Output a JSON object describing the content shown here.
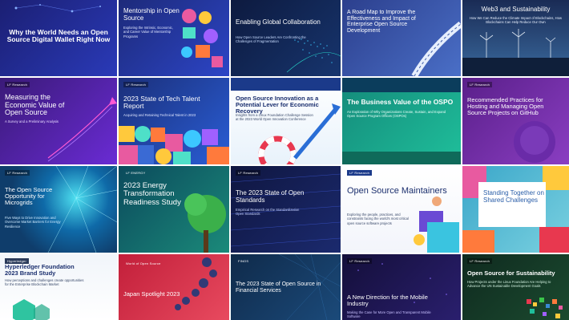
{
  "tiles": [
    {
      "title": "Why the World Needs an Open Source Digital Wallet Right Now",
      "subtitle": "",
      "colors": [
        "#1b1f73",
        "#2a3ab8"
      ]
    },
    {
      "title": "Mentorship in Open Source",
      "subtitle": "Exploring the Intrinsic, Economic, and Career Value of Mentorship Programs",
      "colors": [
        "#1d2a7a",
        "#2c45c6"
      ]
    },
    {
      "title": "Enabling Global Collaboration",
      "subtitle": "How Open Source Leaders Are Confronting the Challenges of Fragmentation",
      "colors": [
        "#0d1a3f",
        "#17356e"
      ]
    },
    {
      "title": "A Road Map to Improve the Effectiveness and Impact of Enterprise Open Source Development",
      "subtitle": "",
      "colors": [
        "#2c3f8d",
        "#4a6fc7"
      ]
    },
    {
      "title": "Web3 and Sustainability",
      "subtitle": "How We Can Reduce the Climate Impact of Blockchains, How Blockchains Can Help Reduce Our Own",
      "colors": [
        "#1a2b55",
        "#3a6a9e"
      ]
    },
    {
      "title": "Measuring the Economic Value of Open Source",
      "subtitle": "A Survey and a Preliminary Analysis",
      "colors": [
        "#3a1a78",
        "#6a2bd4"
      ]
    },
    {
      "title": "2023 State of Tech Talent Report",
      "subtitle": "Acquiring and Retaining Technical Talent in 2023",
      "colors": [
        "#1b2f7a",
        "#2a5ed6"
      ]
    },
    {
      "title": "Open Source Innovation as a Potential Lever for Economic Recovery",
      "subtitle": "Insights from a Linux Foundation Challenge Session at the 2023 World Open Innovation Conference",
      "colors": [
        "#ffffff",
        "#e8f2fb"
      ]
    },
    {
      "title": "The Business Value of the OSPO",
      "subtitle": "An Exploration of Why Organizations Create, Sustain, and Expand Open Source Program Offices (OSPOs)",
      "colors": [
        "#148a7a",
        "#1fbf9b"
      ]
    },
    {
      "title": "Recommended Practices for Hosting and Managing Open Source Projects on GitHub",
      "subtitle": "",
      "colors": [
        "#5a1f8a",
        "#8a3ec2"
      ]
    },
    {
      "title": "The Open Source Opportunity for Microgrids",
      "subtitle": "Five Ways to Drive Innovation and Overcome Market Barriers for Energy Resilience",
      "colors": [
        "#0f3d6b",
        "#1f6fa8"
      ]
    },
    {
      "title": "2023 Energy Transformation Readiness Study",
      "subtitle": "",
      "colors": [
        "#0b4a5c",
        "#1b8a7a"
      ]
    },
    {
      "title": "The 2023 State of Open Standards",
      "subtitle": "Empirical Research on the Standardization Open Standards",
      "colors": [
        "#0f1640",
        "#1b2a6e"
      ]
    },
    {
      "title": "Open Source Maintainers",
      "subtitle": "Exploring the people, practices, and constraints facing the world's most critical open source software projects",
      "colors": [
        "#ffffff",
        "#f3f5fb"
      ]
    },
    {
      "title": "Standing Together on Shared Challenges",
      "subtitle": "",
      "colors": [
        "#3aa6c9",
        "#7ad1e0"
      ]
    },
    {
      "title": "Hyperledger Foundation 2023 Brand Study",
      "subtitle": "How perceptions and challenges create opportunities for the Enterprise Blockchain Market",
      "colors": [
        "#f1f5fa",
        "#ffffff"
      ]
    },
    {
      "title": "Japan Spotlight 2023",
      "subtitle": "",
      "colors": [
        "#c21f3a",
        "#e84a5f"
      ]
    },
    {
      "title": "The 2023 State of Open Source in Financial Services",
      "subtitle": "",
      "colors": [
        "#0f2a4a",
        "#1b4a7a"
      ]
    },
    {
      "title": "A New Direction for the Mobile Industry",
      "subtitle": "Making the Case for More Open and Transparent Mobile Software",
      "colors": [
        "#140f3a",
        "#2a1f6e"
      ]
    },
    {
      "title": "Open Source for Sustainability",
      "subtitle": "How Projects under the Linux Foundation Are Helping to Advance the UN Sustainable Development Goals",
      "colors": [
        "#0f2a1f",
        "#1b4a2f"
      ]
    }
  ]
}
